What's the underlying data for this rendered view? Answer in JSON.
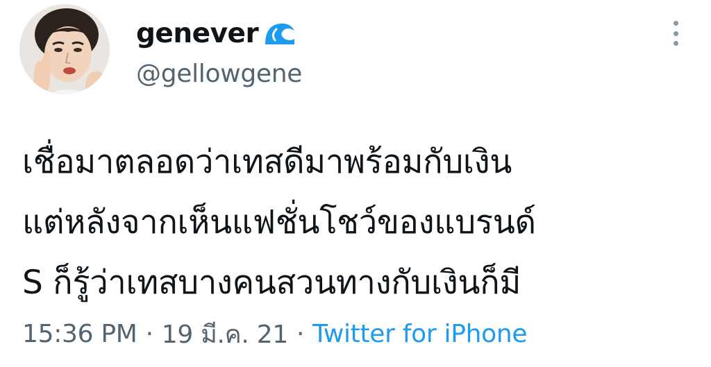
{
  "tweet": {
    "author": {
      "display_name": "genever",
      "name_icon": "wave-icon",
      "handle": "@gellowgene",
      "avatar": "avatar"
    },
    "more_icon": "more-vertical-icon",
    "body_lines": [
      "เชื่อมาตลอดว่าเทสดีมาพร้อมกับเงิน",
      "แต่หลังจากเห็นแฟชั่นโชว์ของแบรนด์",
      "S ก็รู้ว่าเทสบางคนสวนทางกับเงินก็มี"
    ],
    "time": "15:36 PM",
    "date": "19 มี.ค. 21",
    "separator": "·",
    "source": "Twitter for iPhone",
    "colors": {
      "text": "#0f1419",
      "secondary": "#536471",
      "link": "#1d9bf0",
      "wave": "#1d9bf0"
    }
  }
}
